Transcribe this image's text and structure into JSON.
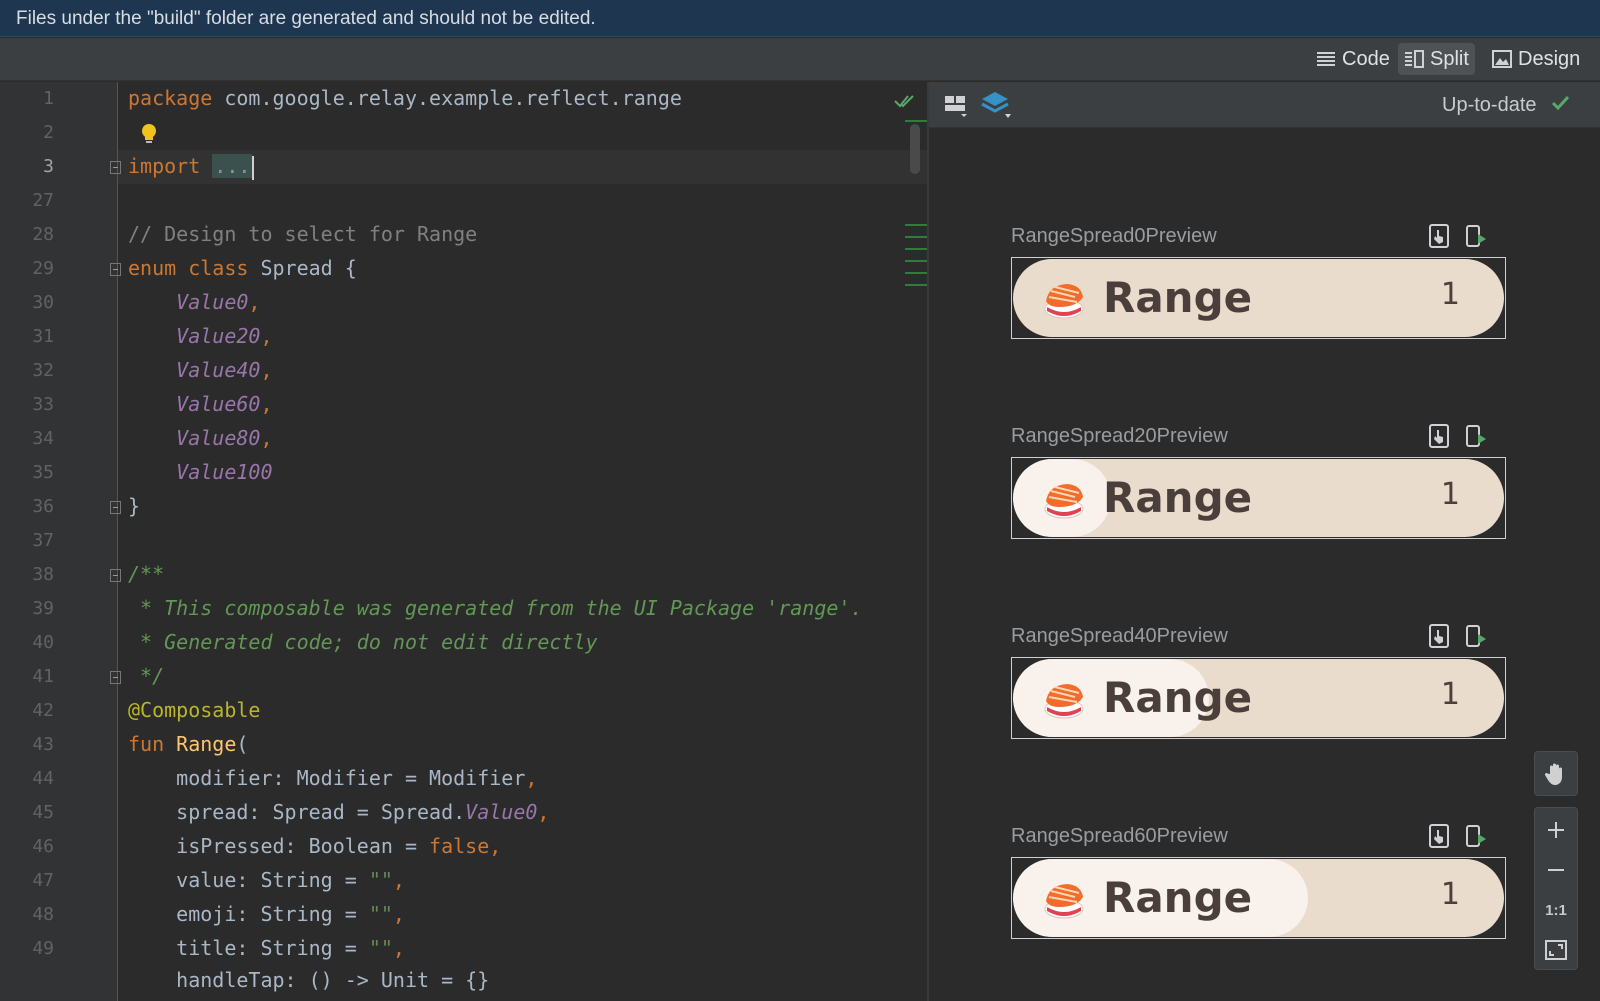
{
  "banner": {
    "text": "Files under the \"build\" folder are generated and should not be edited."
  },
  "toolbar": {
    "modes": [
      {
        "label": "Code",
        "icon": "lines-icon",
        "active": false
      },
      {
        "label": "Split",
        "icon": "split-icon",
        "active": true
      },
      {
        "label": "Design",
        "icon": "image-icon",
        "active": false
      }
    ]
  },
  "editor": {
    "lines": [
      {
        "num": "1"
      },
      {
        "num": "2"
      },
      {
        "num": "3"
      },
      {
        "num": "27"
      },
      {
        "num": "28"
      },
      {
        "num": "29"
      },
      {
        "num": "30"
      },
      {
        "num": "31"
      },
      {
        "num": "32"
      },
      {
        "num": "33"
      },
      {
        "num": "34"
      },
      {
        "num": "35"
      },
      {
        "num": "36"
      },
      {
        "num": "37"
      },
      {
        "num": "38"
      },
      {
        "num": "39"
      },
      {
        "num": "40"
      },
      {
        "num": "41"
      },
      {
        "num": "42"
      },
      {
        "num": "43"
      },
      {
        "num": "44"
      },
      {
        "num": "45"
      },
      {
        "num": "46"
      },
      {
        "num": "47"
      },
      {
        "num": "48"
      },
      {
        "num": "49"
      }
    ],
    "tokens": {
      "l1_kw": "package",
      "l1_rest": " com.google.relay.example.reflect.range",
      "l3_kw": "import",
      "l3_folded": "...",
      "l28": "// Design to select for Range",
      "l29_kw": "enum class",
      "l29_rest": " Spread {",
      "l30": "Value0",
      "l31": "Value20",
      "l32": "Value40",
      "l33": "Value60",
      "l34": "Value80",
      "l35": "Value100",
      "comma": ",",
      "l36": "}",
      "l38": "/**",
      "l39": " * This composable was generated from the UI Package 'range'.",
      "l40": " * Generated code; do not edit directly",
      "l41": " */",
      "l42": "@Composable",
      "l43_kw": "fun",
      "l43_fn": "Range",
      "l43_rest": "(",
      "l44": "modifier: Modifier = Modifier",
      "l45_a": "spread: Spread = Spread.",
      "l45_b": "Value0",
      "l46_a": "isPressed: Boolean = ",
      "l46_b": "false",
      "l47_a": "value: String = ",
      "l48_a": "emoji: String = ",
      "l49_a": "title: String = ",
      "empty_str": "\"\"",
      "l50": "handleTap: () -> Unit = {}"
    }
  },
  "preview": {
    "status": "Up-to-date",
    "cards": [
      {
        "label": "RangeSpread0Preview",
        "title": "Range",
        "value": "1",
        "spread_percent": 0
      },
      {
        "label": "RangeSpread20Preview",
        "title": "Range",
        "value": "1",
        "spread_percent": 20
      },
      {
        "label": "RangeSpread40Preview",
        "title": "Range",
        "value": "1",
        "spread_percent": 40
      },
      {
        "label": "RangeSpread60Preview",
        "title": "Range",
        "value": "1",
        "spread_percent": 60
      }
    ],
    "zoom": {
      "one_to_one": "1:1"
    }
  }
}
